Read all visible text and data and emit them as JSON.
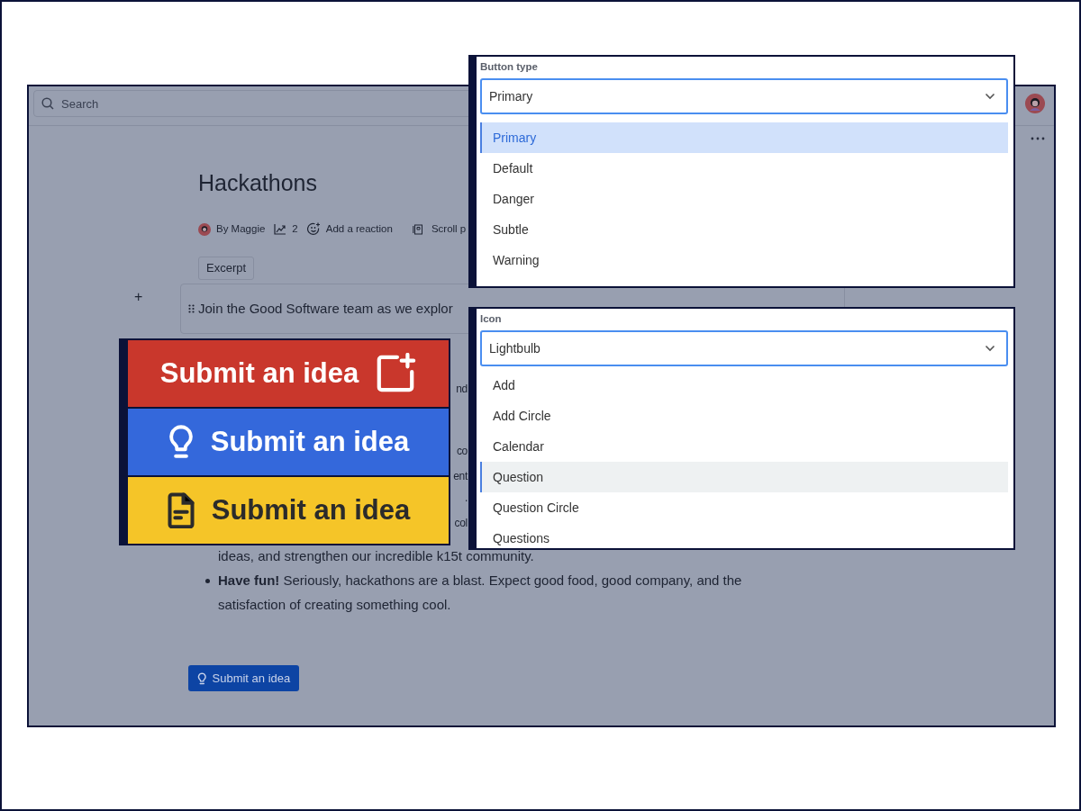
{
  "app": {
    "search": {
      "placeholder": "Search"
    },
    "title": "Hackathons",
    "byline": {
      "author": "By Maggie",
      "views": "2",
      "reaction": "Add a reaction",
      "scroll": "Scroll p"
    },
    "excerpt_tag": "Excerpt",
    "add_symbol": "+",
    "excerpt_text": "Join the Good Software team as we explor",
    "covered_fragments": [
      "nd",
      "co",
      "ent",
      ".",
      "col"
    ],
    "list": [
      {
        "text": "ideas, and strengthen our incredible k15t community.",
        "bullet": false
      },
      {
        "text": "**Have fun!** Seriously, hackathons are a blast. Expect good food, good company, and the satisfaction of creating something cool.",
        "bullet": true
      }
    ],
    "button": {
      "label": "Submit an idea"
    }
  },
  "button_previews": [
    {
      "label": "Submit an idea",
      "kind": "danger"
    },
    {
      "label": "Submit an idea",
      "kind": "primary"
    },
    {
      "label": "Submit an idea",
      "kind": "warning"
    }
  ],
  "button_type": {
    "label": "Button type",
    "value": "Primary",
    "options": [
      {
        "label": "Primary",
        "selected": true,
        "focused": false
      },
      {
        "label": "Default",
        "selected": false,
        "focused": false
      },
      {
        "label": "Danger",
        "selected": false,
        "focused": false
      },
      {
        "label": "Subtle",
        "selected": false,
        "focused": false
      },
      {
        "label": "Warning",
        "selected": false,
        "focused": false
      }
    ]
  },
  "icon_select": {
    "label": "Icon",
    "value": "Lightbulb",
    "options": [
      {
        "label": "Add",
        "selected": false,
        "focused": false
      },
      {
        "label": "Add Circle",
        "selected": false,
        "focused": false
      },
      {
        "label": "Calendar",
        "selected": false,
        "focused": false
      },
      {
        "label": "Question",
        "selected": false,
        "focused": true
      },
      {
        "label": "Question Circle",
        "selected": false,
        "focused": false
      },
      {
        "label": "Questions",
        "selected": false,
        "focused": false
      }
    ]
  }
}
